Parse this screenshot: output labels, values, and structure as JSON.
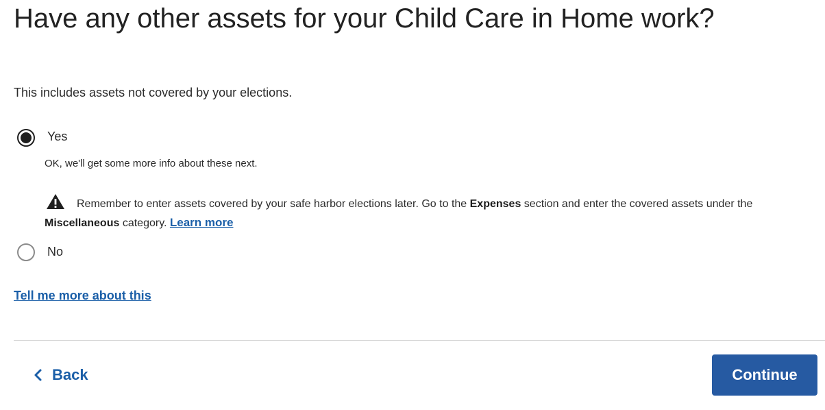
{
  "page": {
    "title": "Have any other assets for your Child Care in Home work?",
    "subtitle": "This includes assets not covered by your elections."
  },
  "options": {
    "yes": {
      "label": "Yes",
      "selected": true,
      "followup": "OK, we'll get some more info about these next."
    },
    "no": {
      "label": "No",
      "selected": false
    }
  },
  "warning": {
    "icon": "warning-icon",
    "text_before": "Remember to enter assets covered by your safe harbor elections later. Go to the ",
    "bold_expenses": "Expenses",
    "text_middle": " section and enter the covered assets under the ",
    "bold_misc": "Miscellaneous",
    "text_after": " category. ",
    "link": "Learn more"
  },
  "help_link": "Tell me more about this",
  "footer": {
    "back_label": "Back",
    "back_icon": "chevron-left-icon",
    "continue_label": "Continue"
  },
  "colors": {
    "link": "#1b5fa8",
    "primary_button": "#265aa2",
    "text": "#2b2b2b",
    "divider": "#d6d6d6"
  }
}
